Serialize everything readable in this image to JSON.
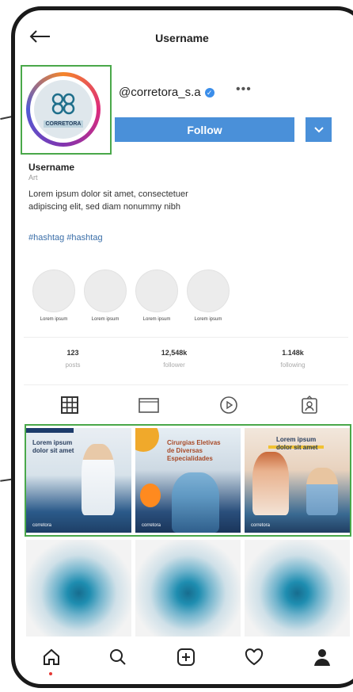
{
  "header": {
    "back_icon": "arrow-left-icon",
    "title": "Username"
  },
  "profile": {
    "avatar_logo_text": "CORRETORA",
    "handle": "@corretora_s.a",
    "verified_icon": "verified-badge-icon",
    "more_icon": "more-dots-icon",
    "follow_label": "Follow",
    "dropdown_icon": "chevron-down-icon",
    "display_name": "Username",
    "category": "Art",
    "bio": "Lorem ipsum dolor sit amet, consectetuer adipiscing elit, sed diam nonummy nibh",
    "hashtags": "#hashtag  #hashtag"
  },
  "highlights": [
    {
      "label": "Lorem ipsum"
    },
    {
      "label": "Lorem ipsum"
    },
    {
      "label": "Lorem ipsum"
    },
    {
      "label": "Lorem ipsum"
    }
  ],
  "stats": [
    {
      "value": "123",
      "label": "posts"
    },
    {
      "value": "12,548k",
      "label": "follower"
    },
    {
      "value": "1.148k",
      "label": "following"
    }
  ],
  "tabs": [
    {
      "icon": "grid-icon"
    },
    {
      "icon": "igtv-icon"
    },
    {
      "icon": "reels-play-icon"
    },
    {
      "icon": "tagged-user-icon"
    }
  ],
  "posts": [
    {
      "title": "Lorem ipsum dolor sit amet",
      "footer": "corretora"
    },
    {
      "title": "Cirurgias Eletivas de Diversas Especialidades",
      "footer": "corretora"
    },
    {
      "title": "Lorem ipsum dolor sit amet",
      "footer": "corretora"
    }
  ],
  "nav": [
    {
      "icon": "home-icon"
    },
    {
      "icon": "search-icon"
    },
    {
      "icon": "add-post-icon"
    },
    {
      "icon": "heart-icon"
    },
    {
      "icon": "profile-icon"
    }
  ],
  "colors": {
    "follow_button": "#4a90d9",
    "highlight_box": "#4aa84a",
    "link": "#3a6ea8"
  }
}
